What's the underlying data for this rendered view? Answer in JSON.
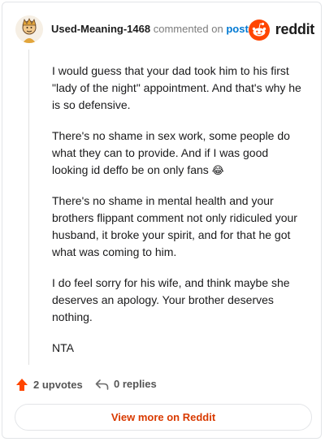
{
  "header": {
    "username": "Used-Meaning-1468",
    "commented_on": "commented on",
    "post_link": "post",
    "brand": "reddit",
    "brand_color": "#ff4500"
  },
  "comment": {
    "paragraphs": [
      "I would guess that your dad took him to his first \"lady of the night\" appointment. And that's why he is so defensive.",
      "There's no shame in sex work, some people do what they can to provide. And if I was good looking id deffo be on only fans",
      "There's no shame in mental health and your brothers flippant comment not only ridiculed your husband, it broke your spirit, and for that he got what was coming to him.",
      "I do feel sorry for his wife, and think maybe she deserves an apology. Your brother deserves nothing.",
      "NTA"
    ],
    "emoji": "😂"
  },
  "actions": {
    "upvotes": "2 upvotes",
    "replies": "0 replies",
    "upvote_icon": "upvote-arrow-icon",
    "reply_icon": "reply-icon"
  },
  "footer": {
    "view_more": "View more on Reddit",
    "accent_color": "#d93a00"
  }
}
